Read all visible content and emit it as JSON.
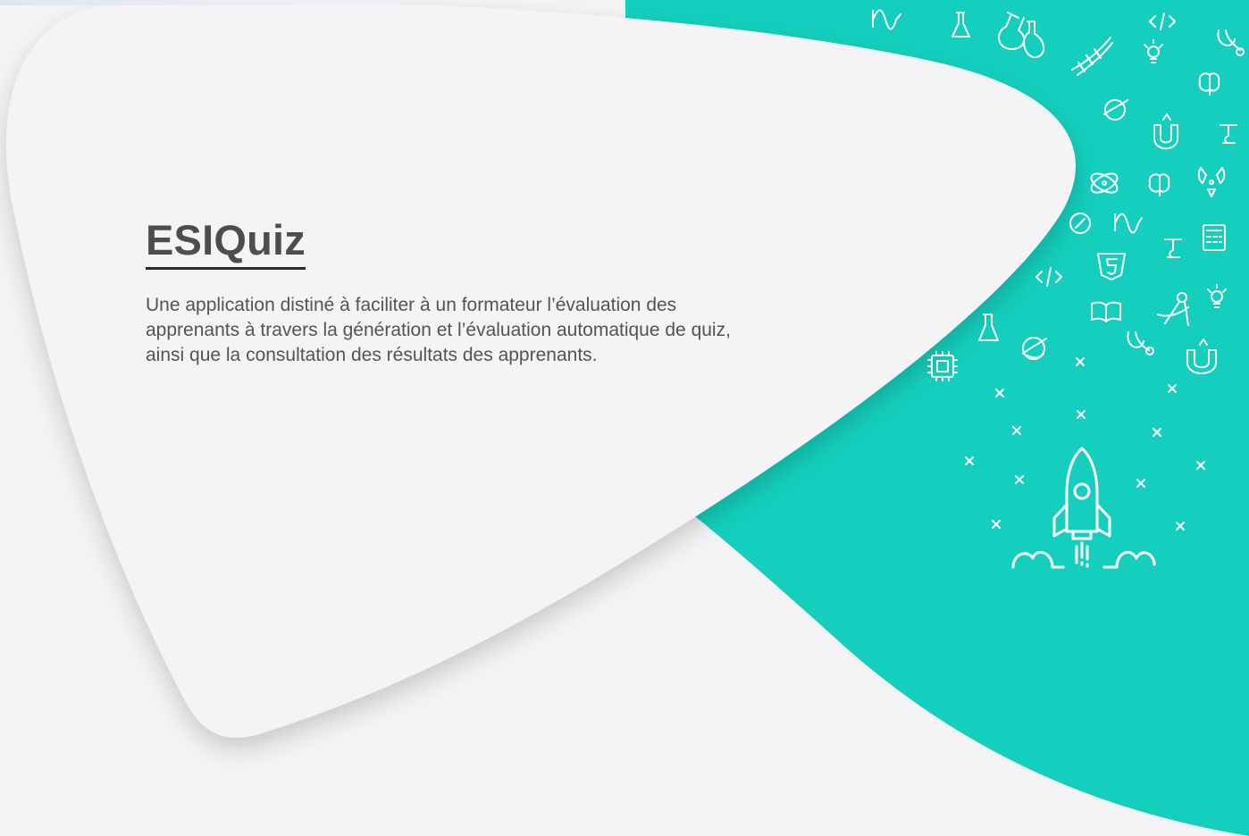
{
  "app": {
    "title": "ESIQuiz",
    "description": "Une application  distiné à faciliter à un formateur l’évaluation des apprenants à travers la génération et l’évaluation automatique de quiz, ainsi que la consultation des résultats des apprenants."
  },
  "colors": {
    "background": "#f4f3f5",
    "accent": "#14cfbd",
    "card": "#f4f3f5",
    "title": "#4e4c4c",
    "text": "#545454",
    "icon": "#ffffff"
  },
  "decorations": {
    "icons": [
      "wave-icon",
      "flask-icon",
      "flasks-icon",
      "code-icon",
      "stethoscope-icon",
      "dna-icon",
      "lightbulb-icon",
      "brain-icon",
      "planet-icon",
      "magnet-icon",
      "microscope-icon",
      "atom-icon",
      "radiation-icon",
      "calculator-icon",
      "compass-icon",
      "html5-icon",
      "book-icon",
      "drawing-compass-icon",
      "chip-icon",
      "rocket-icon",
      "sparkle-icon"
    ]
  }
}
